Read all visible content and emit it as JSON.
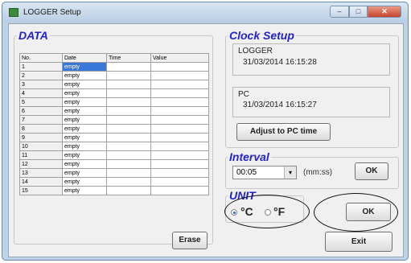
{
  "window": {
    "title": "LOGGER Setup",
    "minimize_glyph": "–",
    "maximize_glyph": "□",
    "close_glyph": "✕"
  },
  "data_group": {
    "title": "DATA",
    "columns": [
      "No.",
      "Date",
      "Time",
      "Value"
    ],
    "rows": [
      {
        "num": "1",
        "date": "empty",
        "time": "",
        "value": ""
      },
      {
        "num": "2",
        "date": "empty",
        "time": "",
        "value": ""
      },
      {
        "num": "3",
        "date": "empty",
        "time": "",
        "value": ""
      },
      {
        "num": "4",
        "date": "empty",
        "time": "",
        "value": ""
      },
      {
        "num": "5",
        "date": "empty",
        "time": "",
        "value": ""
      },
      {
        "num": "6",
        "date": "empty",
        "time": "",
        "value": ""
      },
      {
        "num": "7",
        "date": "empty",
        "time": "",
        "value": ""
      },
      {
        "num": "8",
        "date": "empty",
        "time": "",
        "value": ""
      },
      {
        "num": "9",
        "date": "empty",
        "time": "",
        "value": ""
      },
      {
        "num": "10",
        "date": "empty",
        "time": "",
        "value": ""
      },
      {
        "num": "11",
        "date": "empty",
        "time": "",
        "value": ""
      },
      {
        "num": "12",
        "date": "empty",
        "time": "",
        "value": ""
      },
      {
        "num": "13",
        "date": "empty",
        "time": "",
        "value": ""
      },
      {
        "num": "14",
        "date": "empty",
        "time": "",
        "value": ""
      },
      {
        "num": "15",
        "date": "empty",
        "time": "",
        "value": ""
      }
    ],
    "erase_label": "Erase"
  },
  "clock": {
    "title": "Clock Setup",
    "logger_label": "LOGGER",
    "logger_value": "31/03/2014 16:15:28",
    "pc_label": "PC",
    "pc_value": "31/03/2014 16:15:27",
    "adjust_label": "Adjust to PC time"
  },
  "interval": {
    "title": "Interval",
    "value": "00:05",
    "unit_label": "(mm:ss)",
    "ok_label": "OK"
  },
  "unit": {
    "title": "UNIT",
    "celsius_label": "°C",
    "fahrenheit_label": "°F",
    "selected": "celsius"
  },
  "ok_label": "OK",
  "exit_label": "Exit",
  "colors": {
    "group_title": "#2222d0",
    "selection": "#3a78d8"
  }
}
